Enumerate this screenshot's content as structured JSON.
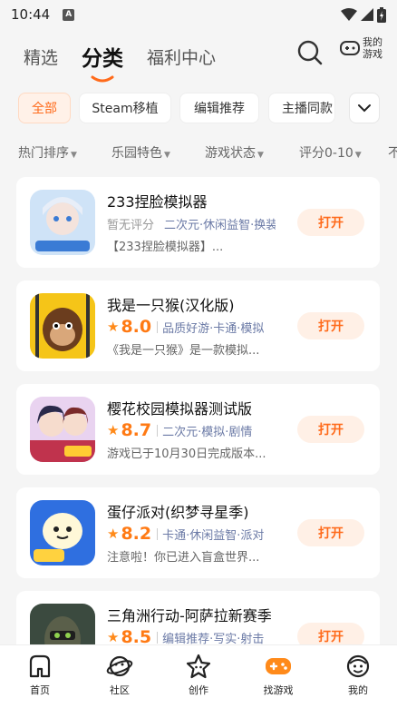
{
  "status": {
    "time": "10:44",
    "notif_letter": "A"
  },
  "topnav": {
    "tabs": [
      {
        "label": "精选"
      },
      {
        "label": "分类"
      },
      {
        "label": "福利中心"
      }
    ],
    "my_games_label": "我的游戏"
  },
  "chips": [
    {
      "label": "全部"
    },
    {
      "label": "Steam移植"
    },
    {
      "label": "编辑推荐"
    },
    {
      "label": "主播同款"
    }
  ],
  "filters": [
    {
      "label": "热门排序"
    },
    {
      "label": "乐园特色"
    },
    {
      "label": "游戏状态"
    },
    {
      "label": "评分0-10"
    },
    {
      "label": "不"
    }
  ],
  "games": [
    {
      "title": "233捏脸模拟器",
      "score": "",
      "no_score_label": "暂无评分",
      "tags": "二次元·休闲益智·换装",
      "desc": "【233捏脸模拟器】...",
      "button": "打开"
    },
    {
      "title": "我是一只猴(汉化版)",
      "score": "8.0",
      "tags": "品质好游·卡通·模拟",
      "desc": "《我是一只猴》是一款模拟...",
      "button": "打开"
    },
    {
      "title": "樱花校园模拟器测试版",
      "score": "8.7",
      "tags": "二次元·模拟·剧情",
      "desc": "游戏已于10月30日完成版本...",
      "button": "打开"
    },
    {
      "title": "蛋仔派对(织梦寻星季)",
      "score": "8.2",
      "tags": "卡通·休闲益智·派对",
      "desc": "注意啦！你已进入盲盒世界...",
      "button": "打开"
    },
    {
      "title": "三角洲行动-阿萨拉新赛季",
      "score": "8.5",
      "tags": "编辑推荐·写实·射击",
      "desc": "",
      "button": "打开"
    }
  ],
  "bottomnav": [
    {
      "label": "首页"
    },
    {
      "label": "社区"
    },
    {
      "label": "创作"
    },
    {
      "label": "找游戏"
    },
    {
      "label": "我的"
    }
  ],
  "colors": {
    "accent": "#ff6a1a",
    "tag_text": "#6b7aa6"
  }
}
